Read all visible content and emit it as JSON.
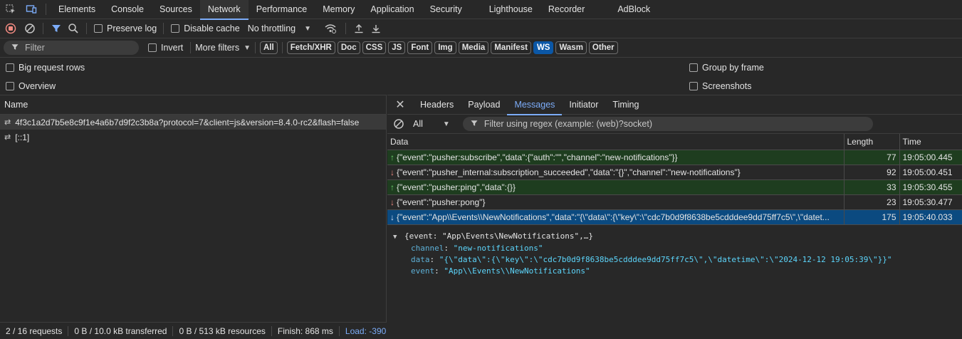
{
  "tabs": [
    "Elements",
    "Console",
    "Sources",
    "Network",
    "Performance",
    "Memory",
    "Application",
    "Security",
    "Lighthouse",
    "Recorder",
    "AdBlock"
  ],
  "active_tab": "Network",
  "toolbar": {
    "preserve_log": "Preserve log",
    "disable_cache": "Disable cache",
    "throttling": "No throttling"
  },
  "filterbar": {
    "placeholder": "Filter",
    "invert": "Invert",
    "more_filters": "More filters",
    "types": [
      "All",
      "Fetch/XHR",
      "Doc",
      "CSS",
      "JS",
      "Font",
      "Img",
      "Media",
      "Manifest",
      "WS",
      "Wasm",
      "Other"
    ],
    "active_type": "WS"
  },
  "options": {
    "big_rows": "Big request rows",
    "overview": "Overview",
    "group_by_frame": "Group by frame",
    "screenshots": "Screenshots"
  },
  "requests": {
    "header": "Name",
    "items": [
      "4f3c1a2d7b5e8c9f1e4a6b7d9f2c3b8a?protocol=7&client=js&version=8.4.0-rc2&flash=false",
      "[::1]"
    ]
  },
  "status": {
    "requests": "2 / 16 requests",
    "transferred": "0 B / 10.0 kB transferred",
    "resources": "0 B / 513 kB resources",
    "finish": "Finish: 868 ms",
    "load": "Load: -390"
  },
  "detail": {
    "tabs": [
      "Headers",
      "Payload",
      "Messages",
      "Initiator",
      "Timing"
    ],
    "active": "Messages",
    "direction_filter": "All",
    "regex_placeholder": "Filter using regex (example: (web)?socket)"
  },
  "messages": {
    "columns": [
      "Data",
      "Length",
      "Time"
    ],
    "rows": [
      {
        "dir": "sent",
        "data": "{\"event\":\"pusher:subscribe\",\"data\":{\"auth\":\"\",\"channel\":\"new-notifications\"}}",
        "length": "77",
        "time": "19:05:00.445"
      },
      {
        "dir": "recv",
        "data": "{\"event\":\"pusher_internal:subscription_succeeded\",\"data\":\"{}\",\"channel\":\"new-notifications\"}",
        "length": "92",
        "time": "19:05:00.451"
      },
      {
        "dir": "sent",
        "data": "{\"event\":\"pusher:ping\",\"data\":{}}",
        "length": "33",
        "time": "19:05:30.455"
      },
      {
        "dir": "recv",
        "data": "{\"event\":\"pusher:pong\"}",
        "length": "23",
        "time": "19:05:30.477"
      },
      {
        "dir": "recv-selected",
        "data": "{\"event\":\"App\\\\Events\\\\NewNotifications\",\"data\":\"{\\\"data\\\":{\\\"key\\\":\\\"cdc7b0d9f8638be5cdddee9dd75ff7c5\\\",\\\"datet...",
        "length": "175",
        "time": "19:05:40.033"
      }
    ]
  },
  "preview": {
    "summary": "{event: \"App\\Events\\NewNotifications\",…}",
    "channel_key": "channel",
    "channel_val": "\"new-notifications\"",
    "data_key": "data",
    "data_val": "\"{\\\"data\\\":{\\\"key\\\":\\\"cdc7b0d9f8638be5cdddee9dd75ff7c5\\\",\\\"datetime\\\":\\\"2024-12-12 19:05:39\\\"}}\"",
    "event_key": "event",
    "event_val": "\"App\\\\Events\\\\NewNotifications\""
  }
}
